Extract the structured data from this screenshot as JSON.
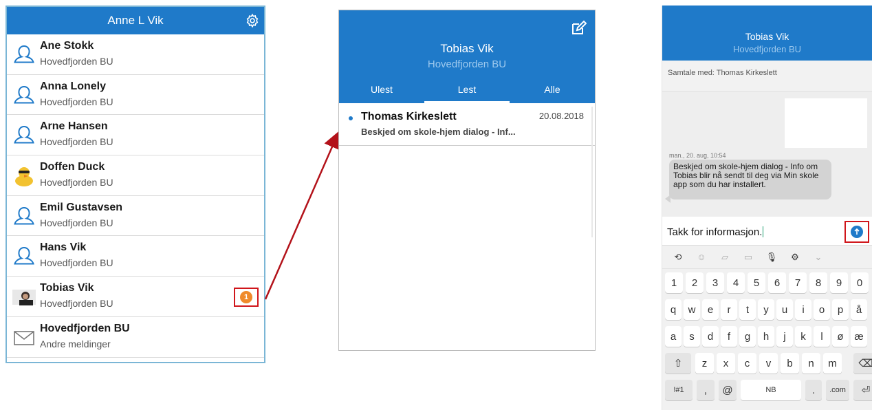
{
  "panel1": {
    "header_title": "Anne L Vik",
    "contacts": [
      {
        "name": "Ane Stokk",
        "sub": "Hovedfjorden BU",
        "avatar": "person-outline-icon"
      },
      {
        "name": "Anna Lonely",
        "sub": "Hovedfjorden BU",
        "avatar": "person-outline-icon"
      },
      {
        "name": "Arne Hansen",
        "sub": "Hovedfjorden BU",
        "avatar": "person-outline-icon"
      },
      {
        "name": "Doffen Duck",
        "sub": "Hovedfjorden BU",
        "avatar": "duck-avatar"
      },
      {
        "name": "Emil Gustavsen",
        "sub": "Hovedfjorden BU",
        "avatar": "person-outline-icon"
      },
      {
        "name": "Hans Vik",
        "sub": "Hovedfjorden BU",
        "avatar": "person-outline-icon"
      },
      {
        "name": "Tobias Vik",
        "sub": "Hovedfjorden BU",
        "avatar": "photo-avatar",
        "badge": "1"
      },
      {
        "name": "Hovedfjorden BU",
        "sub": "Andre meldinger",
        "avatar": "envelope-icon"
      }
    ]
  },
  "panel2": {
    "title": "Tobias Vik",
    "subtitle": "Hovedfjorden BU",
    "tabs": [
      "Ulest",
      "Lest",
      "Alle"
    ],
    "active_tab": "Lest",
    "messages": [
      {
        "from": "Thomas Kirkeslett",
        "date": "20.08.2018",
        "preview": "Beskjed om skole-hjem dialog - Inf..."
      }
    ]
  },
  "panel3": {
    "title": "Tobias Vik",
    "subtitle": "Hovedfjorden BU",
    "samtale": "Samtale med:  Thomas Kirkeslett",
    "timestamp": "man., 20. aug, 10:54",
    "bubble_text": "Beskjed om skole-hjem dialog - Info om Tobias blir nå sendt til deg via Min skole app som du har installert.",
    "input_value": "Takk for informasjon.",
    "keyboard": {
      "numbers": [
        "1",
        "2",
        "3",
        "4",
        "5",
        "6",
        "7",
        "8",
        "9",
        "0"
      ],
      "row1": [
        "q",
        "w",
        "e",
        "r",
        "t",
        "y",
        "u",
        "i",
        "o",
        "p",
        "å"
      ],
      "row2": [
        "a",
        "s",
        "d",
        "f",
        "g",
        "h",
        "j",
        "k",
        "l",
        "ø",
        "æ"
      ],
      "row3": [
        "z",
        "x",
        "c",
        "v",
        "b",
        "n",
        "m"
      ],
      "sym": "!#1",
      "comma": ",",
      "at": "@",
      "space": "NB",
      "period": ".",
      "com": ".com"
    }
  },
  "colors": {
    "brand": "#1f7ac9",
    "badge": "#ef8a2b",
    "highlight": "#d0161b",
    "arrow": "#b3121a"
  }
}
